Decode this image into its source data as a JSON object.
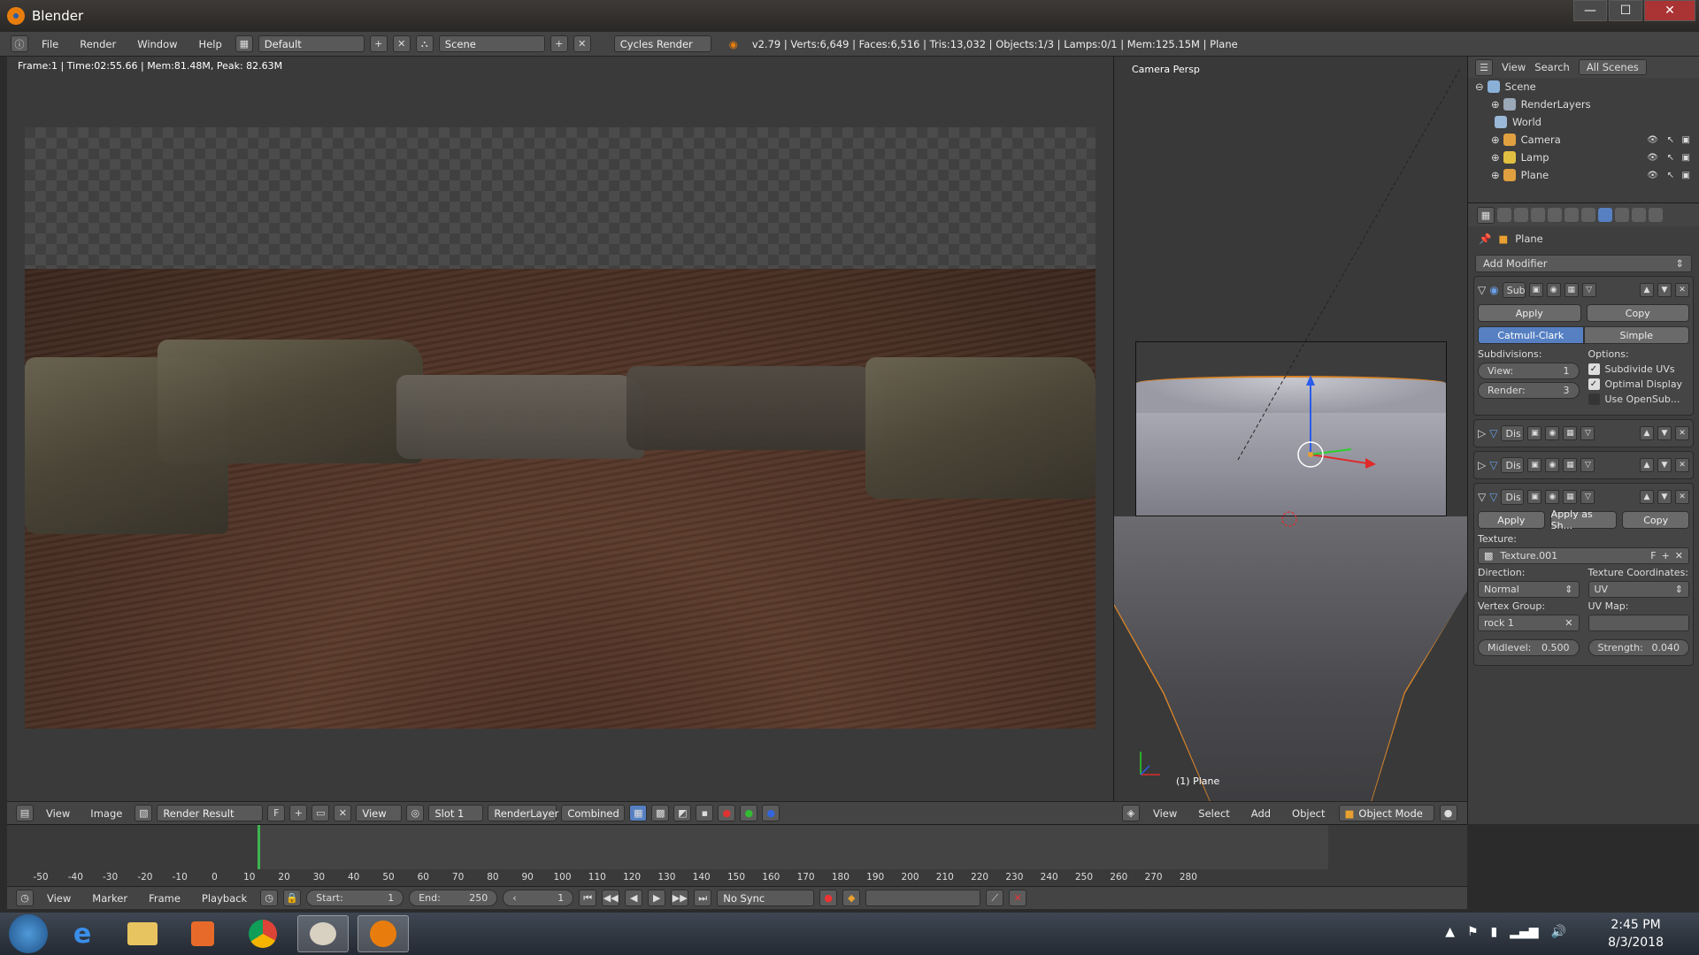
{
  "window": {
    "title": "Blender",
    "min": "—",
    "max": "☐",
    "close": "✕"
  },
  "menu": {
    "file": "File",
    "render": "Render",
    "window": "Window",
    "help": "Help"
  },
  "header": {
    "layout": "Default",
    "scene": "Scene",
    "engine": "Cycles Render",
    "stats": "v2.79 | Verts:6,649 | Faces:6,516 | Tris:13,032 | Objects:1/3 | Lamps:0/1 | Mem:125.15M | Plane"
  },
  "render_view": {
    "info": "Frame:1 | Time:02:55.66 | Mem:81.48M, Peak: 82.63M",
    "footer": {
      "view": "View",
      "image": "Image",
      "image_name": "Render Result",
      "f": "F",
      "view2": "View",
      "slot": "Slot 1",
      "layer": "RenderLayer",
      "pass": "Combined"
    }
  },
  "viewport": {
    "label": "Camera Persp",
    "object": "(1) Plane",
    "footer": {
      "view": "View",
      "select": "Select",
      "add": "Add",
      "object": "Object",
      "mode": "Object Mode"
    }
  },
  "outliner": {
    "header": {
      "view": "View",
      "search": "Search",
      "scenes": "All Scenes"
    },
    "items": [
      {
        "label": "Scene",
        "color": "#8ab0d8",
        "level": 0
      },
      {
        "label": "RenderLayers",
        "color": "#9aa8b8",
        "level": 1
      },
      {
        "label": "World",
        "color": "#9ab8d8",
        "level": 1
      },
      {
        "label": "Camera",
        "color": "#e0a040",
        "level": 1
      },
      {
        "label": "Lamp",
        "color": "#e0c040",
        "level": 1
      },
      {
        "label": "Plane",
        "color": "#e0a040",
        "level": 1
      }
    ]
  },
  "properties": {
    "context": "Plane",
    "add_modifier": "Add Modifier",
    "subsurf": {
      "name": "Sub",
      "apply": "Apply",
      "copy": "Copy",
      "catmull": "Catmull-Clark",
      "simple": "Simple",
      "subdivisions": "Subdivisions:",
      "options": "Options:",
      "view_label": "View:",
      "view_val": "1",
      "render_label": "Render:",
      "render_val": "3",
      "opt1": "Subdivide UVs",
      "opt2": "Optimal Display",
      "opt3": "Use OpenSub..."
    },
    "dis_collapsed": [
      {
        "name": "Dis"
      },
      {
        "name": "Dis"
      }
    ],
    "dis": {
      "name": "Dis",
      "apply": "Apply",
      "apply_shape": "Apply as Sh...",
      "copy": "Copy",
      "texture_label": "Texture:",
      "texture": "Texture.001",
      "f": "F",
      "direction_label": "Direction:",
      "direction": "Normal",
      "coords_label": "Texture Coordinates:",
      "coords": "UV",
      "vgroup_label": "Vertex Group:",
      "vgroup": "rock 1",
      "uvmap_label": "UV Map:",
      "uvmap": "",
      "midlevel_label": "Midlevel:",
      "midlevel": "0.500",
      "strength_label": "Strength:",
      "strength": "0.040"
    }
  },
  "timeline": {
    "ticks": [
      "-50",
      "-40",
      "-30",
      "-20",
      "-10",
      "0",
      "10",
      "20",
      "30",
      "40",
      "50",
      "60",
      "70",
      "80",
      "90",
      "100",
      "110",
      "120",
      "130",
      "140",
      "150",
      "160",
      "170",
      "180",
      "190",
      "200",
      "210",
      "220",
      "230",
      "240",
      "250",
      "260",
      "270",
      "280"
    ],
    "footer": {
      "view": "View",
      "marker": "Marker",
      "frame": "Frame",
      "playback": "Playback",
      "start_label": "Start:",
      "start": "1",
      "end_label": "End:",
      "end": "250",
      "current": "1",
      "sync": "No Sync"
    }
  },
  "taskbar": {
    "time": "2:45 PM",
    "date": "8/3/2018"
  }
}
